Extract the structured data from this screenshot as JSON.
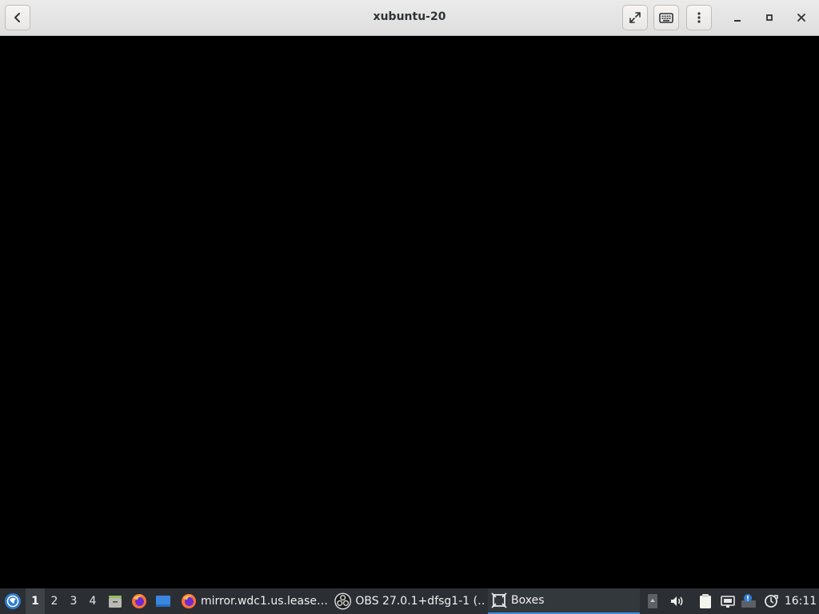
{
  "window": {
    "title": "xubuntu-20",
    "buttons": {
      "back": "back",
      "fullscreen": "fullscreen",
      "keyboard": "send keys",
      "menu": "menu",
      "minimize": "minimize",
      "maximize": "maximize",
      "close": "close"
    }
  },
  "taskbar": {
    "workspaces": [
      "1",
      "2",
      "3",
      "4"
    ],
    "active_workspace": "1",
    "launchers": [
      "file-manager-icon",
      "firefox-icon",
      "desktop-icon"
    ],
    "tasks": [
      {
        "icon": "firefox-icon",
        "label": "mirror.wdc1.us.lease…"
      },
      {
        "icon": "obs-icon",
        "label": "OBS 27.0.1+dfsg1-1 (…"
      },
      {
        "icon": "boxes-icon",
        "label": "Boxes",
        "active": true
      }
    ],
    "tray": [
      "tray-scroll-icon",
      "volume-icon",
      "clipboard-icon",
      "network-icon",
      "notification-icon",
      "update-icon"
    ],
    "clock": "16:11"
  },
  "colors": {
    "header_bg": "#e8e8e7",
    "vm_bg": "#000000",
    "panel_bg": "#2b2f33",
    "active_task_underline": "#3d8ed8"
  }
}
